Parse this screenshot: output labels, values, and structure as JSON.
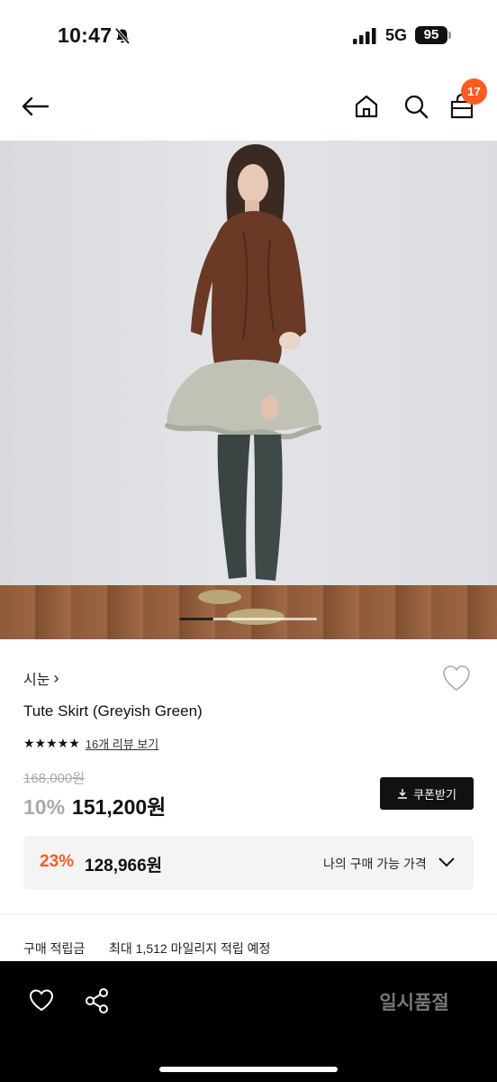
{
  "status": {
    "time": "10:47",
    "network": "5G",
    "battery": "95"
  },
  "header": {
    "cart_count": "17",
    "icons": [
      "arrow-left-icon",
      "home-icon",
      "search-icon",
      "shopping-bag-icon"
    ]
  },
  "carousel": {
    "progress": 0.25
  },
  "product": {
    "brand": "시눈",
    "brand_chevron": "›",
    "name": "Tute Skirt (Greyish Green)",
    "stars": "★★★★★",
    "rating_stars": 5,
    "review_link": "16개 리뷰 보기",
    "original_price": "168,000원",
    "discount": "10%",
    "sale_price": "151,200원",
    "coupon_button": "쿠폰받기"
  },
  "member_price": {
    "discount": "23%",
    "price": "128,966원",
    "label": "나의 구매 가능 가격"
  },
  "points": {
    "label": "구매 적립금",
    "value": "최대 1,512 마일리지 적립 예정"
  },
  "bottom_bar": {
    "status_button": "일시품절"
  },
  "colors": {
    "accent": "#ff5a1f",
    "bottom_bar": "#000000",
    "coupon_button": "#111111"
  }
}
